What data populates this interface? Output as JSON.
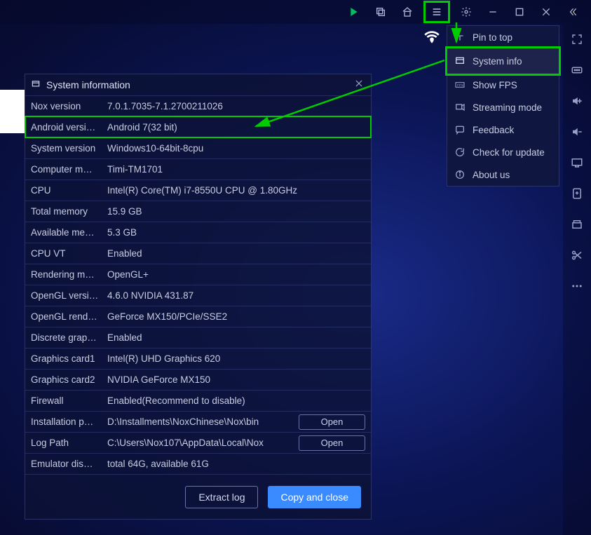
{
  "titlebar": {
    "play": "play-icon",
    "multi": "multi-instance-icon",
    "home": "home-icon",
    "menu": "menu-icon",
    "settings": "gear-icon",
    "minimize": "minimize-icon",
    "maximize": "maximize-icon",
    "close": "close-icon",
    "collapse": "collapse-icon"
  },
  "rightbar": {
    "fullscreen": "fullscreen-icon",
    "keymap": "keymap-icon",
    "volup": "volume-up-icon",
    "voldown": "volume-down-icon",
    "screenshot": "screenshot-icon",
    "apk": "apk-install-icon",
    "files": "file-manager-icon",
    "scissors": "scissors-icon",
    "more": "more-icon"
  },
  "dropdown": {
    "items": [
      {
        "icon": "pin-icon",
        "label": "Pin to top"
      },
      {
        "icon": "info-icon",
        "label": "System info"
      },
      {
        "icon": "fps-icon",
        "label": "Show FPS"
      },
      {
        "icon": "stream-icon",
        "label": "Streaming mode"
      },
      {
        "icon": "feedback-icon",
        "label": "Feedback"
      },
      {
        "icon": "update-icon",
        "label": "Check for update"
      },
      {
        "icon": "about-icon",
        "label": "About us"
      }
    ]
  },
  "dialog": {
    "title": "System information",
    "rows": [
      {
        "k": "Nox version",
        "v": "7.0.1.7035-7.1.2700211026"
      },
      {
        "k": "Android versi…",
        "v": "Android 7(32 bit)"
      },
      {
        "k": "System version",
        "v": "Windows10-64bit-8cpu"
      },
      {
        "k": "Computer m…",
        "v": "Timi-TM1701"
      },
      {
        "k": "CPU",
        "v": "Intel(R) Core(TM) i7-8550U CPU @ 1.80GHz"
      },
      {
        "k": "Total memory",
        "v": "15.9 GB"
      },
      {
        "k": "Available me…",
        "v": "5.3 GB"
      },
      {
        "k": "CPU VT",
        "v": "Enabled"
      },
      {
        "k": "Rendering m…",
        "v": "OpenGL+"
      },
      {
        "k": "OpenGL versi…",
        "v": "4.6.0 NVIDIA 431.87"
      },
      {
        "k": "OpenGL rend…",
        "v": "GeForce MX150/PCIe/SSE2"
      },
      {
        "k": "Discrete grap…",
        "v": "Enabled"
      },
      {
        "k": "Graphics card1",
        "v": "Intel(R) UHD Graphics 620"
      },
      {
        "k": "Graphics card2",
        "v": "NVIDIA GeForce MX150"
      },
      {
        "k": "Firewall",
        "v": "Enabled(Recommend to disable)"
      },
      {
        "k": "Installation p…",
        "v": "D:\\Installments\\NoxChinese\\Nox\\bin",
        "open": true
      },
      {
        "k": "Log Path",
        "v": "C:\\Users\\Nox107\\AppData\\Local\\Nox",
        "open": true
      },
      {
        "k": "Emulator dis…",
        "v": "total  64G, available 61G"
      }
    ],
    "open_label": "Open",
    "extract_label": "Extract log",
    "copy_label": "Copy and close"
  }
}
